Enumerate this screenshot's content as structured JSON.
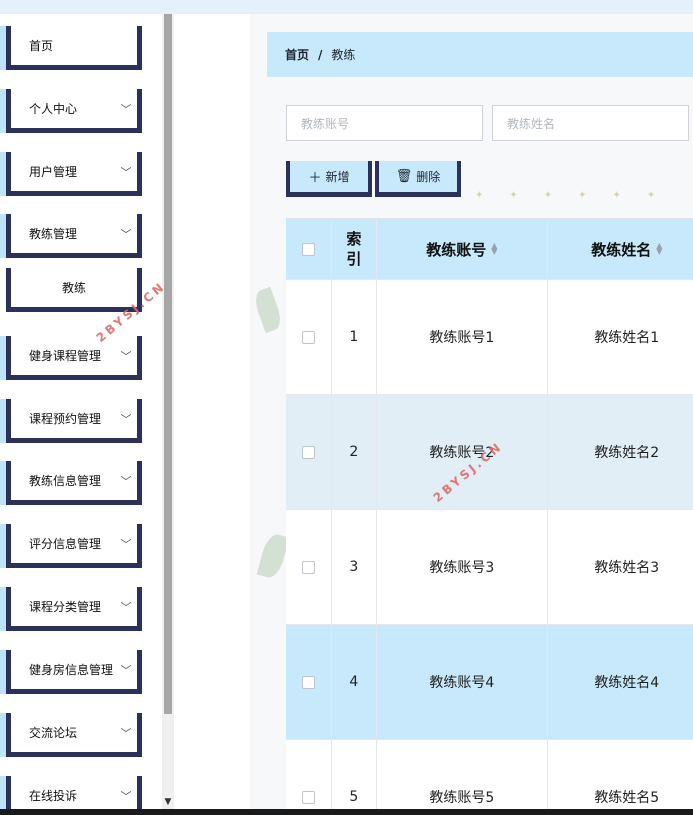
{
  "sidebar": {
    "items": [
      {
        "label": "首页",
        "has_arrow": false
      },
      {
        "label": "个人中心",
        "has_arrow": true
      },
      {
        "label": "用户管理",
        "has_arrow": true
      },
      {
        "label": "教练管理",
        "has_arrow": true
      },
      {
        "label": "教练",
        "has_arrow": false,
        "sub": true
      },
      {
        "label": "健身课程管理",
        "has_arrow": true
      },
      {
        "label": "课程预约管理",
        "has_arrow": true
      },
      {
        "label": "教练信息管理",
        "has_arrow": true
      },
      {
        "label": "评分信息管理",
        "has_arrow": true
      },
      {
        "label": "课程分类管理",
        "has_arrow": true
      },
      {
        "label": "健身房信息管理",
        "has_arrow": true
      },
      {
        "label": "交流论坛",
        "has_arrow": true
      },
      {
        "label": "在线投诉",
        "has_arrow": true
      }
    ]
  },
  "breadcrumb": {
    "home": "首页",
    "separator": "/",
    "current": "教练"
  },
  "search": {
    "account_placeholder": "教练账号",
    "name_placeholder": "教练姓名"
  },
  "toolbar": {
    "add_label": "新增",
    "delete_label": "删除"
  },
  "table": {
    "headers": {
      "index": "索引",
      "account": "教练账号",
      "name": "教练姓名"
    },
    "rows": [
      {
        "index": "1",
        "account": "教练账号1",
        "name": "教练姓名1"
      },
      {
        "index": "2",
        "account": "教练账号2",
        "name": "教练姓名2"
      },
      {
        "index": "3",
        "account": "教练账号3",
        "name": "教练姓名3"
      },
      {
        "index": "4",
        "account": "教练账号4",
        "name": "教练姓名4"
      },
      {
        "index": "5",
        "account": "教练账号5",
        "name": "教练姓名5"
      }
    ]
  },
  "watermark": "2BYSJ.CN",
  "colors": {
    "accent": "#c7e9fb",
    "border_dark": "#2b3158"
  }
}
